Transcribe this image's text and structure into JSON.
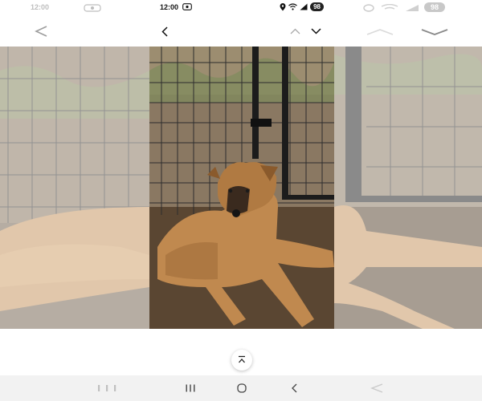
{
  "status_bar": {
    "time": "12:00",
    "battery": "98"
  },
  "left_ghost": {
    "time": "12:00"
  },
  "right_ghost": {
    "battery": "98"
  },
  "icons": {
    "back": "chevron-left-icon",
    "prev": "chevron-up-icon",
    "next": "chevron-down-icon",
    "scroll_top": "scroll-to-top-icon",
    "recents": "recents-icon",
    "home": "home-icon",
    "nav_back": "nav-back-icon"
  },
  "colors": {
    "nav_bar": "#f2f2f2",
    "fur": "#c0894f",
    "soil": "#5a4632"
  }
}
